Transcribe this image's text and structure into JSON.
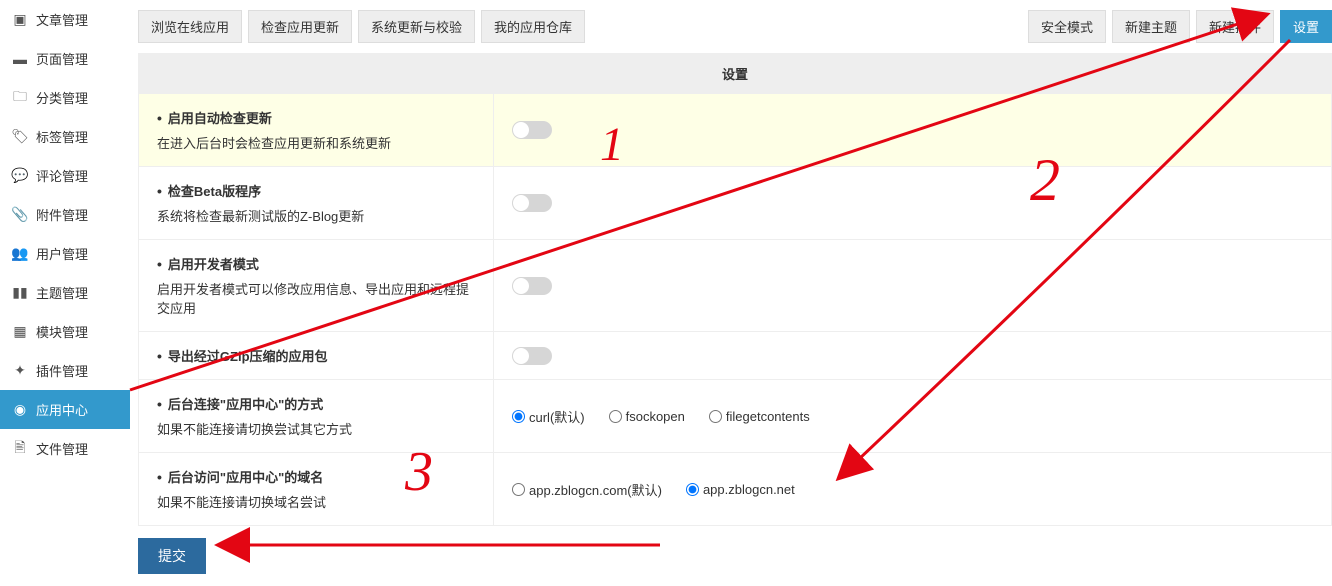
{
  "sidebar": {
    "items": [
      {
        "label": "文章管理",
        "icon": "archive"
      },
      {
        "label": "页面管理",
        "icon": "page"
      },
      {
        "label": "分类管理",
        "icon": "folder"
      },
      {
        "label": "标签管理",
        "icon": "tags"
      },
      {
        "label": "评论管理",
        "icon": "comment"
      },
      {
        "label": "附件管理",
        "icon": "attachment"
      },
      {
        "label": "用户管理",
        "icon": "users"
      },
      {
        "label": "主题管理",
        "icon": "theme"
      },
      {
        "label": "模块管理",
        "icon": "modules"
      },
      {
        "label": "插件管理",
        "icon": "plugin"
      },
      {
        "label": "应用中心",
        "icon": "app",
        "active": true
      },
      {
        "label": "文件管理",
        "icon": "file"
      }
    ]
  },
  "toolbar": {
    "browse_online": "浏览在线应用",
    "check_update": "检查应用更新",
    "system_update": "系统更新与校验",
    "my_repo": "我的应用仓库",
    "safe_mode": "安全模式",
    "new_theme": "新建主题",
    "new_plugin": "新建插件",
    "settings": "设置"
  },
  "panel": {
    "header": "设置",
    "rows": [
      {
        "title": "启用自动检查更新",
        "desc": "在进入后台时会检查应用更新和系统更新",
        "type": "toggle",
        "value": false,
        "highlight": true
      },
      {
        "title": "检查Beta版程序",
        "desc": "系统将检查最新测试版的Z-Blog更新",
        "type": "toggle",
        "value": false
      },
      {
        "title": "启用开发者模式",
        "desc": "启用开发者模式可以修改应用信息、导出应用和远程提交应用",
        "type": "toggle",
        "value": false
      },
      {
        "title": "导出经过GZip压缩的应用包",
        "desc": "",
        "type": "toggle",
        "value": false
      },
      {
        "title": "后台连接\"应用中心\"的方式",
        "desc": "如果不能连接请切换尝试其它方式",
        "type": "radio",
        "options": [
          "curl(默认)",
          "fsockopen",
          "filegetcontents"
        ],
        "selected": 0
      },
      {
        "title": "后台访问\"应用中心\"的域名",
        "desc": "如果不能连接请切换域名尝试",
        "type": "radio",
        "options": [
          "app.zblogcn.com(默认)",
          "app.zblogcn.net"
        ],
        "selected": 1
      }
    ],
    "submit": "提交"
  },
  "annotations": {
    "num1": "1",
    "num2": "2",
    "num3": "3"
  }
}
